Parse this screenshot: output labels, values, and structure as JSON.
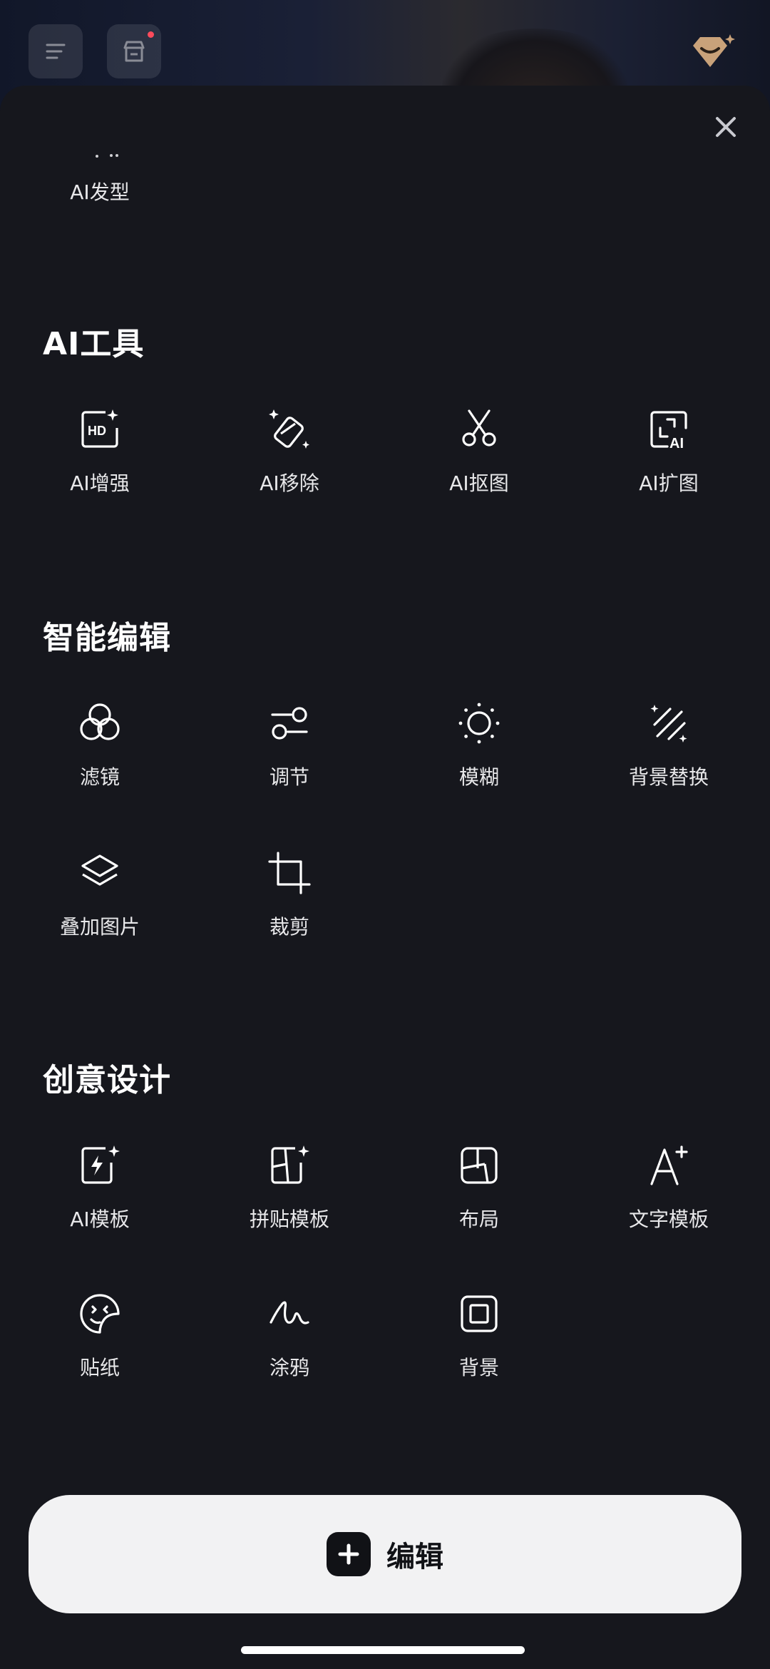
{
  "header": {
    "menu_icon": "menu-icon",
    "store_icon": "store-icon",
    "premium_icon": "premium-crown-icon"
  },
  "sheet": {
    "close_icon": "close-icon",
    "partial_item": {
      "label": "AI发型"
    },
    "sections": [
      {
        "title": "AI工具",
        "items": [
          {
            "label": "AI增强",
            "icon": "hd-sparkle-icon"
          },
          {
            "label": "AI移除",
            "icon": "eraser-sparkle-icon"
          },
          {
            "label": "AI抠图",
            "icon": "scissors-icon"
          },
          {
            "label": "AI扩图",
            "icon": "expand-ai-icon"
          }
        ]
      },
      {
        "title": "智能编辑",
        "items": [
          {
            "label": "滤镜",
            "icon": "filter-circles-icon"
          },
          {
            "label": "调节",
            "icon": "adjust-sliders-icon"
          },
          {
            "label": "模糊",
            "icon": "blur-sun-icon"
          },
          {
            "label": "背景替换",
            "icon": "background-replace-icon"
          },
          {
            "label": "叠加图片",
            "icon": "layers-icon"
          },
          {
            "label": "裁剪",
            "icon": "crop-icon"
          }
        ]
      },
      {
        "title": "创意设计",
        "items": [
          {
            "label": "AI模板",
            "icon": "ai-template-icon"
          },
          {
            "label": "拼贴模板",
            "icon": "collage-template-icon"
          },
          {
            "label": "布局",
            "icon": "layout-icon"
          },
          {
            "label": "文字模板",
            "icon": "text-template-icon"
          },
          {
            "label": "贴纸",
            "icon": "sticker-icon"
          },
          {
            "label": "涂鸦",
            "icon": "doodle-icon"
          },
          {
            "label": "背景",
            "icon": "background-frame-icon"
          }
        ]
      }
    ]
  },
  "footer": {
    "edit_label": "编辑",
    "edit_icon": "plus-icon"
  },
  "colors": {
    "sheet_bg": "#16171d",
    "text": "#ffffff",
    "button_bg": "#f2f2f3",
    "badge_red": "#ff4b5c",
    "premium_gold": "#c9a27a"
  }
}
